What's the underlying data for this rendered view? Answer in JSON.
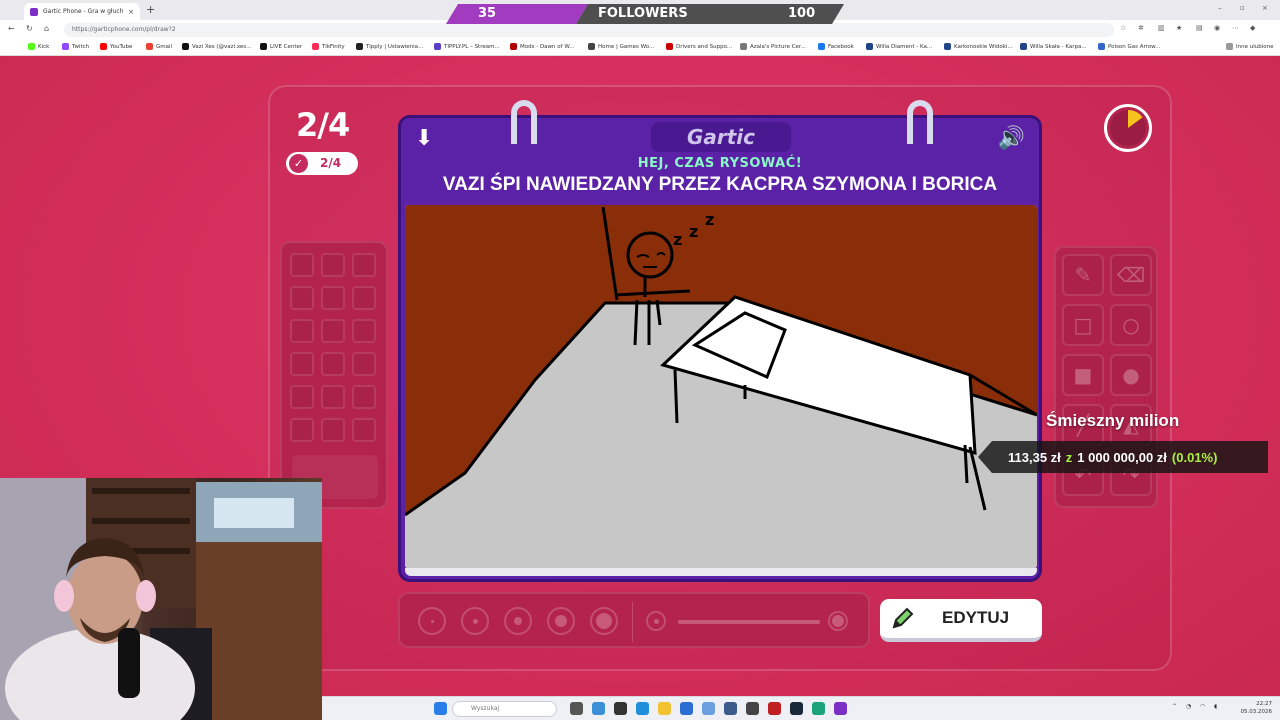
{
  "browser": {
    "tab_title": "Gartic Phone - Gra w głuchy t",
    "tab_close": "×",
    "new_tab": "+",
    "url": "https://garticphone.com/pl/draw?2",
    "bookmarks": [
      {
        "label": "Kick",
        "color": "#53fc18"
      },
      {
        "label": "Twitch",
        "color": "#9146ff"
      },
      {
        "label": "YouTube",
        "color": "#ff0000"
      },
      {
        "label": "Gmail",
        "color": "#ea4335"
      },
      {
        "label": "Vazi Xes (@vazi.xes...",
        "color": "#111111"
      },
      {
        "label": "LIVE Center",
        "color": "#111111"
      },
      {
        "label": "TikFinity",
        "color": "#ff2d55"
      },
      {
        "label": "Tipply | Ustawienia...",
        "color": "#222222"
      },
      {
        "label": "TIPPLY.PL – Stream...",
        "color": "#5b3cc4"
      },
      {
        "label": "Mods - Dawn of W...",
        "color": "#b00000"
      },
      {
        "label": "Home | Games Wo...",
        "color": "#444444"
      },
      {
        "label": "Drivers and Suppo...",
        "color": "#cc0000"
      },
      {
        "label": "Azala's Picture Cer...",
        "color": "#777777"
      },
      {
        "label": "Facebook",
        "color": "#1877f2"
      },
      {
        "label": "Willa Diament - Ka...",
        "color": "#224488"
      },
      {
        "label": "Karkonoskie Widoki...",
        "color": "#224488"
      },
      {
        "label": "Willa Skała - Karpa...",
        "color": "#224488"
      },
      {
        "label": "Poison Gas Arrow...",
        "color": "#3366cc"
      },
      {
        "label": "Inne ulubione",
        "color": "#999999"
      }
    ]
  },
  "followers": {
    "current": "35",
    "label": "FOLLOWERS",
    "goal": "100",
    "progress_fraction": 0.35
  },
  "game": {
    "round": "2/4",
    "done_count": "2/4",
    "brand": "Gartic",
    "hint": "HEJ, CZAS RYSOWAĆ!",
    "prompt": "VAZI ŚPI NAWIEDZANY PRZEZ KACPRA SZYMONA I BORICA",
    "edit_button": "EDYTUJ",
    "timer_remaining_fraction": 0.15,
    "accent": "#5b22a8",
    "background": "#d6305e"
  },
  "donation": {
    "title": "Śmieszny milion",
    "raised": "113,35 zł",
    "separator": "z",
    "goal": "1 000 000,00 zł",
    "percent": "(0.01%)"
  },
  "taskbar": {
    "search_placeholder": "Wyszukaj",
    "time": "22:27",
    "date": "05.03.2026"
  }
}
